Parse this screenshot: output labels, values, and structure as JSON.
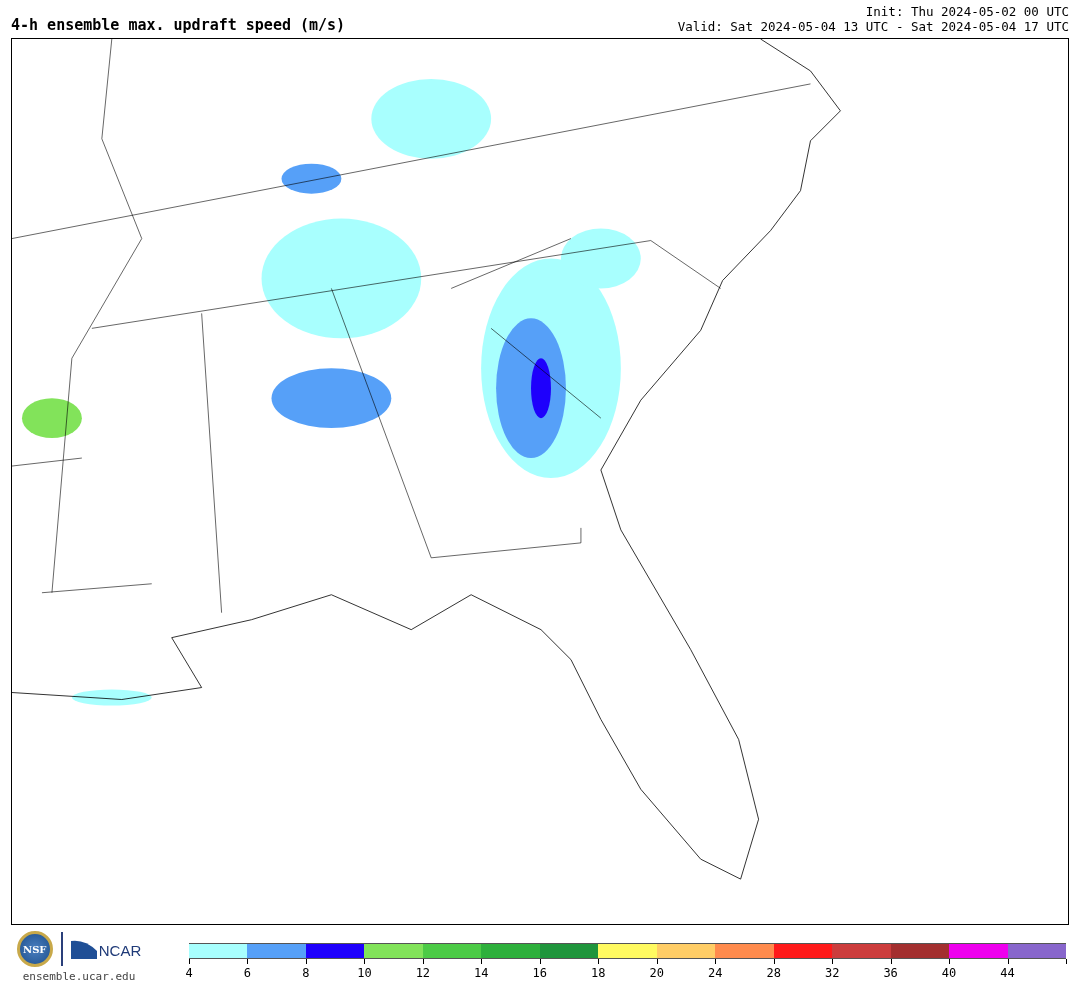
{
  "title": "4-h ensemble max. updraft speed (m/s)",
  "init": "Init: Thu 2024-05-02 00 UTC",
  "valid": "Valid: Sat 2024-05-04 13 UTC - Sat 2024-05-04 17 UTC",
  "logos": {
    "nsf": "NSF",
    "ncar": "NCAR"
  },
  "website": "ensemble.ucar.edu",
  "colorbar": {
    "segments": [
      {
        "color": "#a8fffe",
        "label": "4"
      },
      {
        "color": "#56a0f8",
        "label": "6"
      },
      {
        "color": "#1e00fc",
        "label": "8"
      },
      {
        "color": "#82e35a",
        "label": "10"
      },
      {
        "color": "#4ccb46",
        "label": "12"
      },
      {
        "color": "#2eb03c",
        "label": "14"
      },
      {
        "color": "#1f953c",
        "label": "16"
      },
      {
        "color": "#fffa60",
        "label": "18"
      },
      {
        "color": "#ffcd66",
        "label": "20"
      },
      {
        "color": "#ff8b4d",
        "label": "24"
      },
      {
        "color": "#ff1a1a",
        "label": "28"
      },
      {
        "color": "#cc3d3d",
        "label": "32"
      },
      {
        "color": "#a32f2f",
        "label": "36"
      },
      {
        "color": "#ee00ee",
        "label": "40"
      },
      {
        "color": "#8866cc",
        "label": "44"
      }
    ]
  }
}
